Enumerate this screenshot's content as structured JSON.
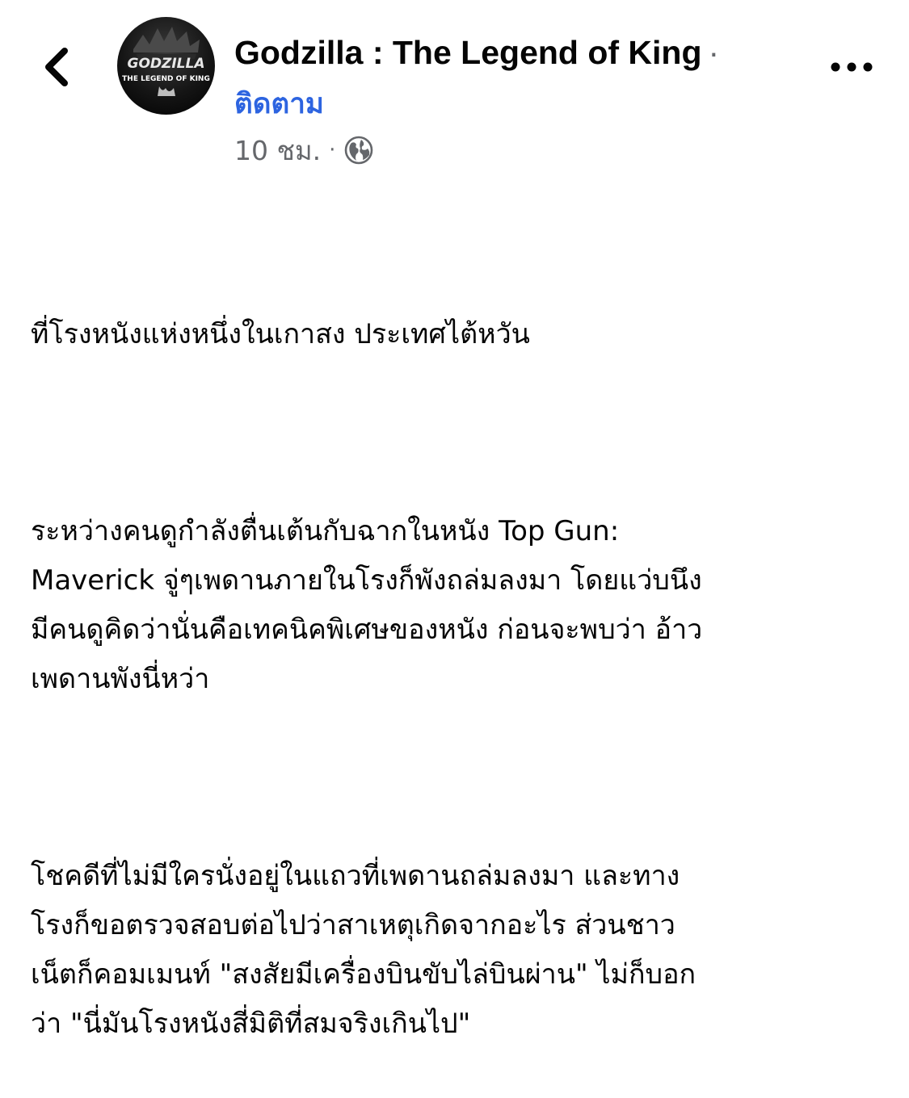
{
  "post": {
    "page_name": "Godzilla : The Legend of King",
    "name_separator": "·",
    "follow_label": "ติดตาม",
    "timestamp": "10 ชม.",
    "meta_separator": "·",
    "privacy_icon": "globe-icon",
    "avatar": {
      "line1": "GODZILLA",
      "line2": "THE LEGEND OF KING"
    },
    "paragraphs": [
      "ที่โรงหนังแห่งหนึ่งในเกาสง ประเทศไต้หวัน",
      "ระหว่างคนดูกำลังตื่นเต้นกับฉากในหนัง Top Gun:\nMaverick จู่ๆเพดานภายในโรงก็พังถล่มลงมา โดยแว่บนึง\nมีคนดูคิดว่านั่นคือเทคนิคพิเศษของหนัง ก่อนจะพบว่า อ้าว\nเพดานพังนี่หว่า",
      "โชคดีที่ไม่มีใครนั่งอยู่ในแถวที่เพดานถล่มลงมา และทาง\nโรงก็ขอตรวจสอบต่อไปว่าสาเหตุเกิดจากอะไร ส่วนชาว\nเน็ตก็คอมเมนท์ \"สงสัยมีเครื่องบินขับไล่บินผ่าน\" ไม่ก็บอก\nว่า \"นี่มันโรงหนังสี่มิติที่สมจริงเกินไป\""
    ]
  },
  "icons": {
    "back": "chevron-left-icon",
    "more": "more-horizontal-icon"
  },
  "colors": {
    "follow_link": "#2d64e0",
    "secondary_text": "#65676b",
    "primary_text": "#050505"
  }
}
